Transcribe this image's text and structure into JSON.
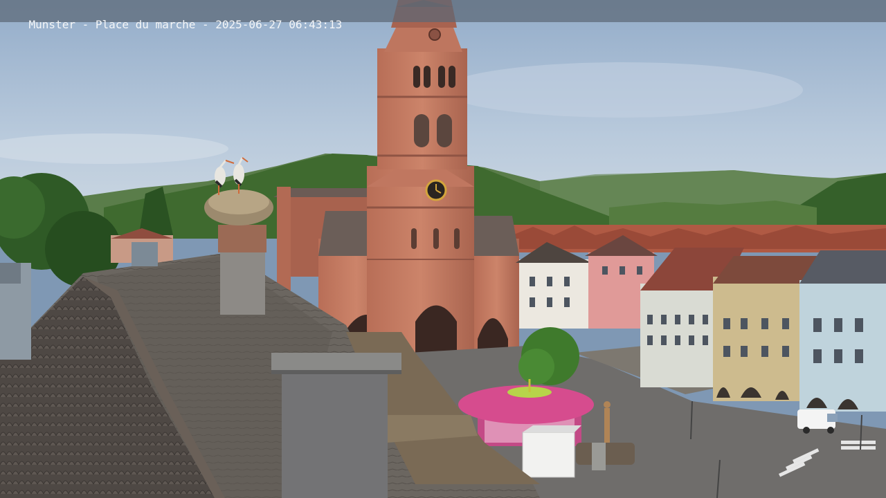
{
  "overlay": {
    "location": "Munster - Place du marche",
    "date": "2025-06-27",
    "time": "06:43:13"
  },
  "colors": {
    "sky_top": "#9db4cf",
    "sky_horizon": "#c9d6e3",
    "sandstone": "#c47a63",
    "sandstone_shadow": "#9c5b49",
    "roof_slate": "#5d5650",
    "hills": "#3e6a2e",
    "kiosk_pink": "#d64c8e"
  },
  "scene_objects": [
    "clock-tower",
    "church-nave",
    "stork-nest",
    "stork",
    "slate-roof",
    "chimney",
    "pink-kiosk",
    "white-van",
    "townhouses",
    "forested-hills"
  ]
}
